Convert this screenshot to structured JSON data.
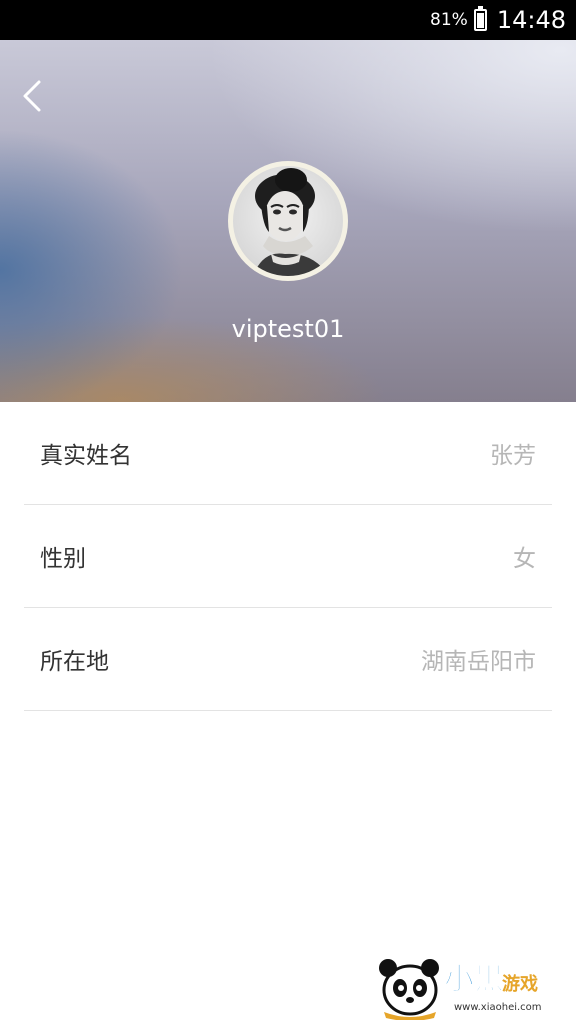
{
  "status_bar": {
    "battery": "81%",
    "time": "14:48"
  },
  "profile": {
    "username": "viptest01"
  },
  "fields": [
    {
      "label": "真实姓名",
      "value": "张芳"
    },
    {
      "label": "性别",
      "value": "女"
    },
    {
      "label": "所在地",
      "value": "湖南岳阳市"
    }
  ],
  "watermark": {
    "name": "小黑",
    "sub": "游戏",
    "url": "www.xiaohei.com"
  },
  "colors": {
    "status_bar_bg": "#000000",
    "label_text": "#333333",
    "value_text": "#b6b6b6",
    "divider": "#e3e3e3"
  },
  "icons": {
    "back": "chevron-left-icon",
    "battery": "battery-icon"
  }
}
